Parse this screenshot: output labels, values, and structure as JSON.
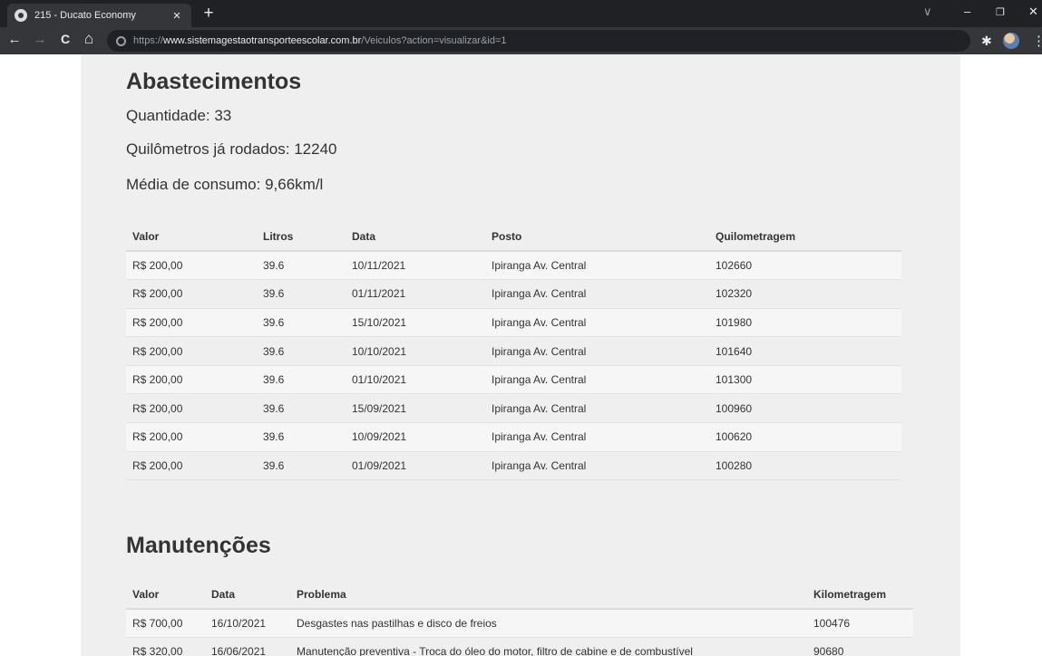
{
  "browser": {
    "tab_title": "215 - Ducato Economy",
    "tab_close": "×",
    "new_tab": "+",
    "url_scheme": "https://",
    "url_host": "www.sistemagestaotransporteescolar.com.br",
    "url_path": "/Veiculos?action=visualizar&id=1",
    "icons": {
      "back": "←",
      "forward": "→",
      "reload": "C",
      "home": "⌂",
      "chevron": "∨",
      "minimize": "–",
      "restore": "❐",
      "close": "✕",
      "extensions": "✱",
      "menu": "⋮"
    }
  },
  "abastecimentos": {
    "title": "Abastecimentos",
    "quantidade": "Quantidade: 33",
    "km_rodados": "Quilômetros já rodados: 12240",
    "media": "Média de consumo: 9,66km/l",
    "columns": [
      "Valor",
      "Litros",
      "Data",
      "Posto",
      "Quilometragem"
    ],
    "rows": [
      [
        "R$ 200,00",
        "39.6",
        "10/11/2021",
        "Ipiranga Av. Central",
        "102660"
      ],
      [
        "R$ 200,00",
        "39.6",
        "01/11/2021",
        "Ipiranga Av. Central",
        "102320"
      ],
      [
        "R$ 200,00",
        "39.6",
        "15/10/2021",
        "Ipiranga Av. Central",
        "101980"
      ],
      [
        "R$ 200,00",
        "39.6",
        "10/10/2021",
        "Ipiranga Av. Central",
        "101640"
      ],
      [
        "R$ 200,00",
        "39.6",
        "01/10/2021",
        "Ipiranga Av. Central",
        "101300"
      ],
      [
        "R$ 200,00",
        "39.6",
        "15/09/2021",
        "Ipiranga Av. Central",
        "100960"
      ],
      [
        "R$ 200,00",
        "39.6",
        "10/09/2021",
        "Ipiranga Av. Central",
        "100620"
      ],
      [
        "R$ 200,00",
        "39.6",
        "01/09/2021",
        "Ipiranga Av. Central",
        "100280"
      ]
    ]
  },
  "manutencoes": {
    "title": "Manutenções",
    "columns": [
      "Valor",
      "Data",
      "Problema",
      "Kilometragem"
    ],
    "rows": [
      [
        "R$ 700,00",
        "16/10/2021",
        "Desgastes nas pastilhas e disco de freios",
        "100476"
      ],
      [
        "R$ 320,00",
        "16/06/2021",
        "Manutenção preventiva - Troca do óleo do motor, filtro de cabine e de combustível",
        "90680"
      ]
    ]
  }
}
